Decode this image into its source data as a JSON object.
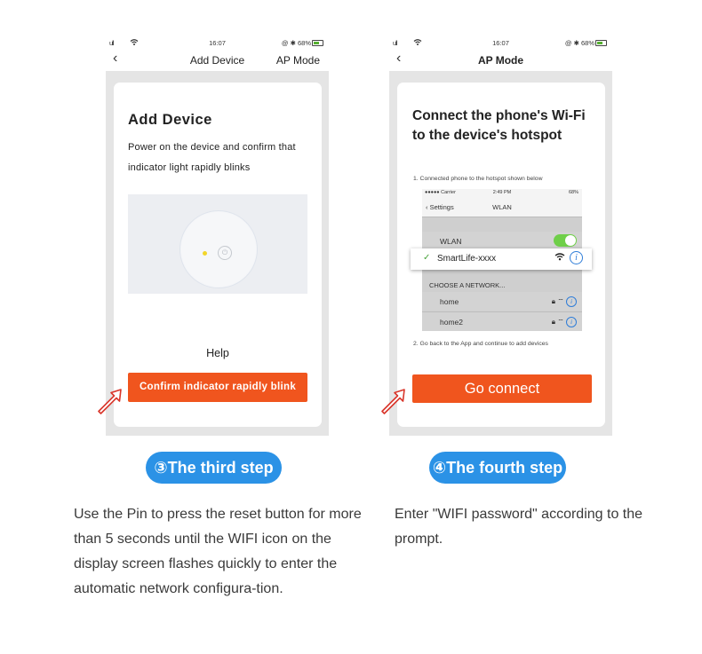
{
  "status_bar": {
    "signal": "ull",
    "time": "16:07",
    "indicators": "@ ✱ 68%"
  },
  "left_phone": {
    "nav": {
      "back": "‹",
      "title": "Add Device",
      "action": "AP Mode"
    },
    "heading": "Add Device",
    "description": "Power on the device and confirm that indicator light rapidly blinks",
    "help_label": "Help",
    "confirm_button": "Confirm indicator rapidly blink",
    "power_glyph": "⏻"
  },
  "right_phone": {
    "nav": {
      "back": "‹",
      "title": "AP Mode"
    },
    "heading": "Connect the phone's Wi-Fi to the device's hotspot",
    "step1": "1. Connected phone to the hotspot shown below",
    "step2": "2. Go back to the App and continue to add devices",
    "go_button": "Go connect",
    "wlan_screenshot": {
      "status_left": "●●●●● Carrier",
      "status_time": "2:49 PM",
      "status_right": "68%",
      "back_label": "Settings",
      "title": "WLAN",
      "wlan_label": "WLAN",
      "wlan_enabled": true,
      "selected_network": "SmartLife-xxxx",
      "section_label": "CHOOSE A NETWORK...",
      "networks": [
        "home",
        "home2"
      ]
    }
  },
  "steps": {
    "third": {
      "label": "③The third step",
      "text": "Use the Pin to press the reset button for more than 5 seconds until the WIFI icon on the display screen flashes quickly to enter the automatic network configura-tion."
    },
    "fourth": {
      "label": "④The fourth step",
      "text": "Enter \"WIFI password\" according to the prompt."
    }
  },
  "colors": {
    "accent_orange": "#f0551e",
    "step_blue": "#2b92e6",
    "toggle_green": "#6fcf49",
    "pointer_red": "#d9362b"
  }
}
